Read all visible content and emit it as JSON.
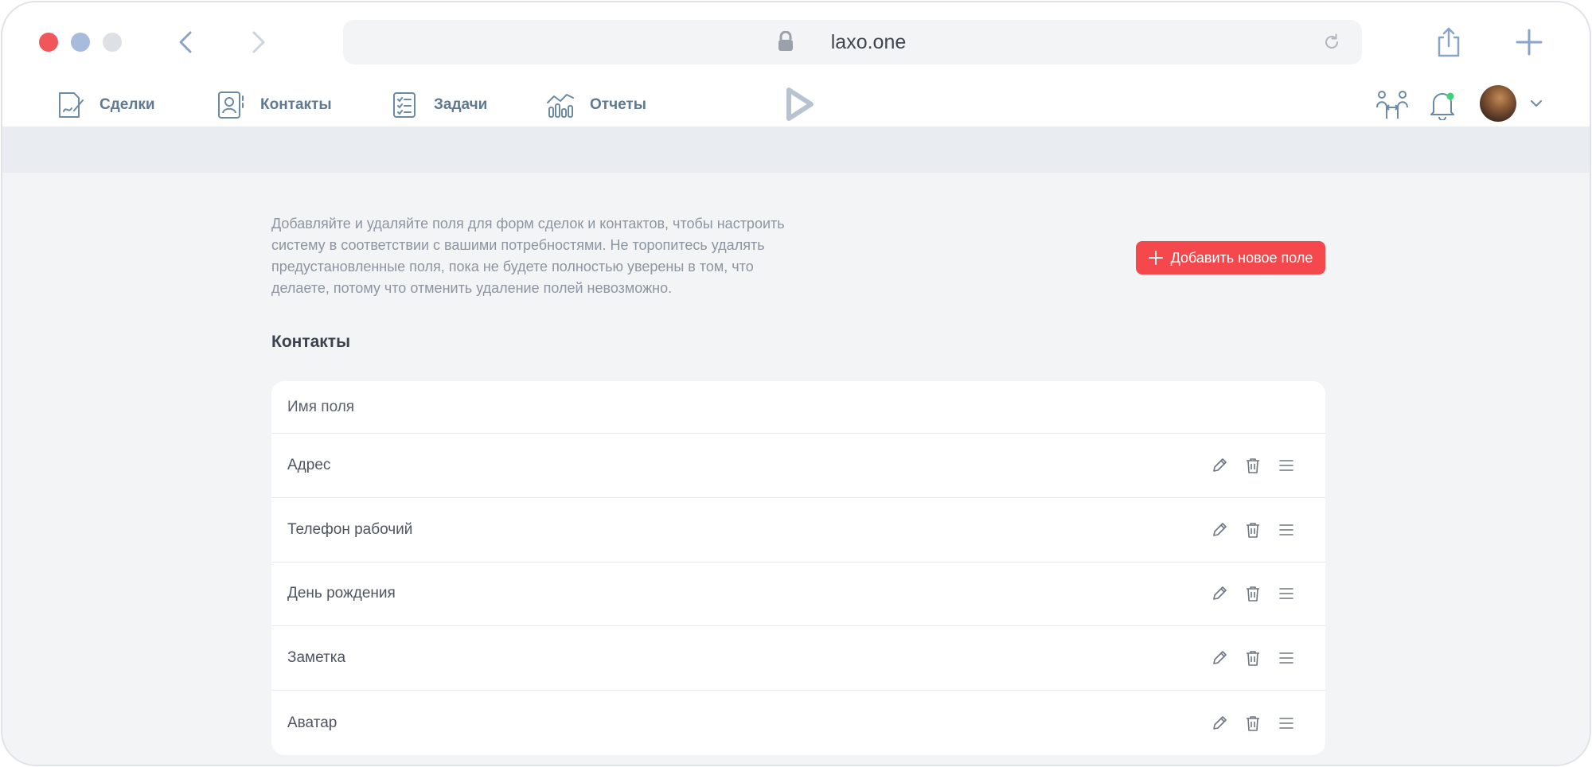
{
  "browser": {
    "url": "laxo.one",
    "icons": [
      "back-icon",
      "forward-icon",
      "lock-icon",
      "reload-icon",
      "share-icon",
      "new-tab-icon"
    ]
  },
  "nav": {
    "items": [
      {
        "label": "Сделки",
        "icon": "deals-icon"
      },
      {
        "label": "Контакты",
        "icon": "contacts-icon"
      },
      {
        "label": "Задачи",
        "icon": "tasks-icon"
      },
      {
        "label": "Отчеты",
        "icon": "reports-icon"
      }
    ]
  },
  "page": {
    "description": "Добавляйте и удаляйте поля для форм сделок и контактов, чтобы настроить систему в соответствии с вашими потребностями. Не торопитесь удалять предустановленные поля, пока не будете полностью уверены в том, что делаете, потому что отменить удаление полей невозможно.",
    "add_button": "Добавить новое поле",
    "section_title": "Контакты",
    "table": {
      "header": "Имя поля",
      "rows": [
        "Адрес",
        "Телефон рабочий",
        "День рождения",
        "Заметка",
        "Аватар"
      ]
    }
  },
  "colors": {
    "accent": "#f4484c",
    "nav_text": "#5e7991",
    "notification_dot": "#3dd17a"
  }
}
